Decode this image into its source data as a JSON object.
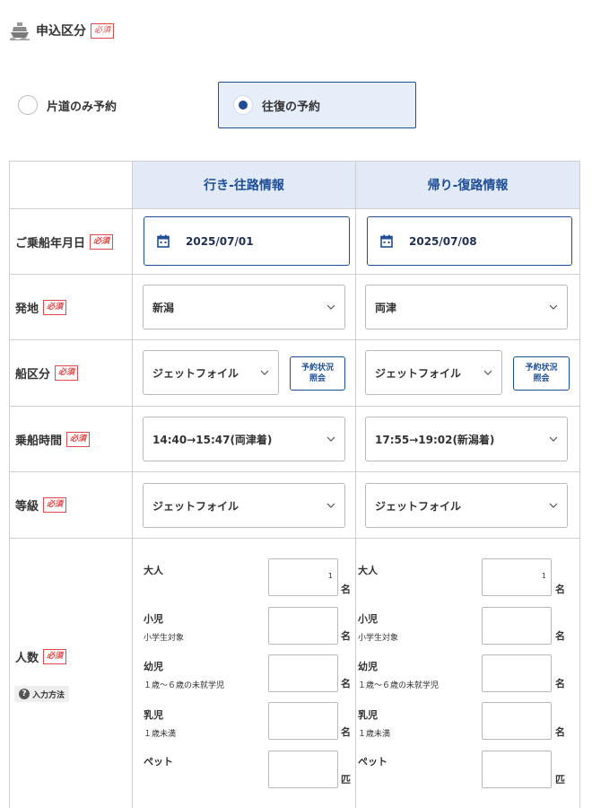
{
  "header": {
    "title": "申込区分",
    "required": "必須"
  },
  "trip_type": {
    "oneway_label": "片道のみ予約",
    "round_label": "往復の予約",
    "selected": "round"
  },
  "table": {
    "col_outbound": "行き-往路情報",
    "col_return": "帰り-復路情報",
    "rows": {
      "date": {
        "label": "ご乗船年月日",
        "required": "必須",
        "outbound": "2025/07/01",
        "return": "2025/07/08"
      },
      "origin": {
        "label": "発地",
        "required": "必須",
        "outbound": "新潟",
        "return": "両津"
      },
      "ship": {
        "label": "船区分",
        "required": "必須",
        "outbound": "ジェットフォイル",
        "return": "ジェットフォイル",
        "status_button_line1": "予約状況",
        "status_button_line2": "照会"
      },
      "time": {
        "label": "乗船時間",
        "required": "必須",
        "outbound": "14:40→15:47(両津着)",
        "return": "17:55→19:02(新潟着)"
      },
      "class": {
        "label": "等級",
        "required": "必須",
        "outbound": "ジェットフォイル",
        "return": "ジェットフォイル"
      },
      "people": {
        "label": "人数",
        "required": "必須",
        "help": "入力方法",
        "adult": {
          "label": "大人",
          "outbound_value": "1",
          "return_value": "1",
          "unit": "名"
        },
        "child": {
          "label": "小児",
          "sub": "小学生対象",
          "unit": "名"
        },
        "infant": {
          "label": "幼児",
          "sub": "１歳～６歳の未就学児",
          "unit": "名"
        },
        "baby": {
          "label": "乳児",
          "sub": "１歳未満",
          "unit": "名"
        },
        "pet": {
          "label": "ペット",
          "unit": "匹"
        }
      }
    }
  },
  "colors": {
    "accent": "#1f4e96",
    "header_bg": "#e1eaf6",
    "required": "#e04a4a",
    "border": "#cfcfcf"
  }
}
